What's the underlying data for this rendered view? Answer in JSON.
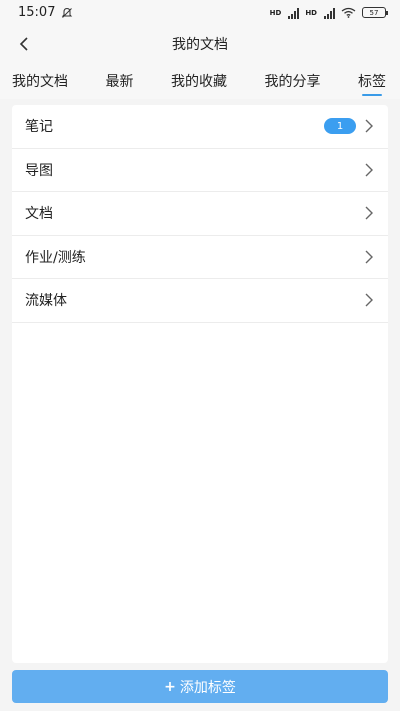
{
  "status_bar": {
    "time": "15:07",
    "battery": "57"
  },
  "header": {
    "title": "我的文档"
  },
  "tabs": [
    {
      "label": "我的文档",
      "active": false
    },
    {
      "label": "最新",
      "active": false
    },
    {
      "label": "我的收藏",
      "active": false
    },
    {
      "label": "我的分享",
      "active": false
    },
    {
      "label": "标签",
      "active": true
    }
  ],
  "tags": [
    {
      "label": "笔记",
      "count": "1"
    },
    {
      "label": "导图"
    },
    {
      "label": "文档"
    },
    {
      "label": "作业/测练"
    },
    {
      "label": "流媒体"
    }
  ],
  "add_button": {
    "label": "添加标签"
  },
  "colors": {
    "accent": "#3b9ef0",
    "button": "#62aef0",
    "background": "#f4f4f4"
  }
}
